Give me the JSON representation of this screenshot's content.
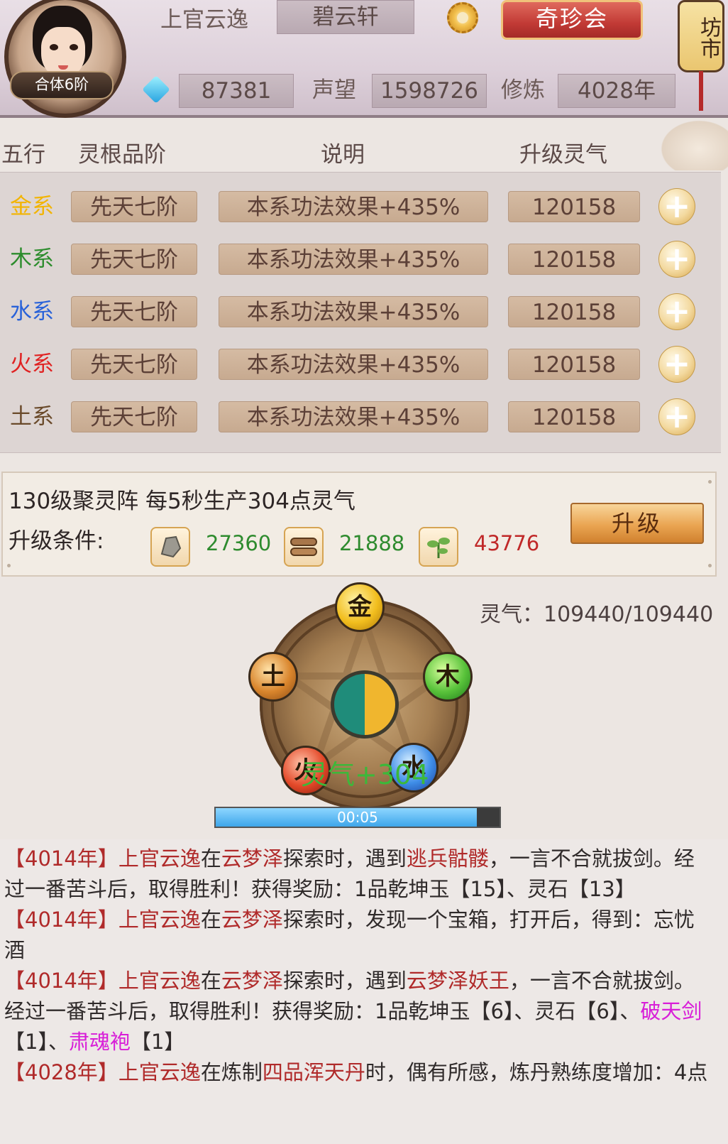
{
  "header": {
    "player_name": "上官云逸",
    "sect_name": "碧云轩",
    "rank": "合体6阶",
    "gems": "87381",
    "reputation_label": "声望",
    "reputation": "1598726",
    "cultivation_label": "修炼",
    "cultivation": "4028年",
    "shop_button": "奇珍会",
    "market_sign": "坊市"
  },
  "table": {
    "headers": [
      "五行",
      "灵根品阶",
      "说明",
      "升级灵气"
    ],
    "rows": [
      {
        "element": "金系",
        "color": "#f2b400",
        "grade": "先天七阶",
        "desc": "本系功法效果+435%",
        "cost": "120158"
      },
      {
        "element": "木系",
        "color": "#2c8c2c",
        "grade": "先天七阶",
        "desc": "本系功法效果+435%",
        "cost": "120158"
      },
      {
        "element": "水系",
        "color": "#2962d9",
        "grade": "先天七阶",
        "desc": "本系功法效果+435%",
        "cost": "120158"
      },
      {
        "element": "火系",
        "color": "#e02222",
        "grade": "先天七阶",
        "desc": "本系功法效果+435%",
        "cost": "120158"
      },
      {
        "element": "土系",
        "color": "#6a4a2a",
        "grade": "先天七阶",
        "desc": "本系功法效果+435%",
        "cost": "120158"
      }
    ]
  },
  "upgrade": {
    "title": "130级聚灵阵  每5秒生产304点灵气",
    "condition_label": "升级条件:",
    "materials": [
      {
        "icon": "ore-icon",
        "value": "27360",
        "color": "#2e8b2e"
      },
      {
        "icon": "wood-icon",
        "value": "21888",
        "color": "#2e8b2e"
      },
      {
        "icon": "herb-icon",
        "value": "43776",
        "color": "#c02828"
      }
    ],
    "button": "升级"
  },
  "formation": {
    "lingqi": "灵气：109440/109440",
    "orbs": {
      "metal": "金",
      "wood": "木",
      "water": "水",
      "fire": "火",
      "earth": "土"
    },
    "gain": "灵气+304",
    "timer": "00:05",
    "progress": 0.92
  },
  "log": [
    [
      {
        "t": "【4014年】",
        "c": "red"
      },
      {
        "t": "上官云逸",
        "c": "red"
      },
      {
        "t": "在",
        "c": ""
      },
      {
        "t": "云梦泽",
        "c": "red"
      },
      {
        "t": "探索时，遇到",
        "c": ""
      },
      {
        "t": "逃兵骷髅",
        "c": "red"
      },
      {
        "t": "，一言不合就拔剑。经过一番苦斗后，取得胜利！获得奖励：1品乾坤玉【15】、灵石【13】",
        "c": ""
      }
    ],
    [
      {
        "t": "【4014年】",
        "c": "red"
      },
      {
        "t": "上官云逸",
        "c": "red"
      },
      {
        "t": "在",
        "c": ""
      },
      {
        "t": "云梦泽",
        "c": "red"
      },
      {
        "t": "探索时，发现一个宝箱，打开后，得到：忘忧酒",
        "c": ""
      }
    ],
    [
      {
        "t": "【4014年】",
        "c": "red"
      },
      {
        "t": "上官云逸",
        "c": "red"
      },
      {
        "t": "在",
        "c": ""
      },
      {
        "t": "云梦泽",
        "c": "red"
      },
      {
        "t": "探索时，遇到",
        "c": ""
      },
      {
        "t": "云梦泽妖王",
        "c": "red"
      },
      {
        "t": "，一言不合就拔剑。经过一番苦斗后，取得胜利！获得奖励：1品乾坤玉【6】、灵石【6】、",
        "c": ""
      },
      {
        "t": "破天剑",
        "c": "pink"
      },
      {
        "t": "【1】、",
        "c": ""
      },
      {
        "t": "肃魂袍",
        "c": "pink"
      },
      {
        "t": "【1】",
        "c": ""
      }
    ],
    [
      {
        "t": "【4028年】",
        "c": "red"
      },
      {
        "t": "上官云逸",
        "c": "red"
      },
      {
        "t": "在炼制",
        "c": ""
      },
      {
        "t": "四品浑天丹",
        "c": "red"
      },
      {
        "t": "时，偶有所感，炼丹熟练度增加：4点",
        "c": ""
      }
    ]
  ]
}
